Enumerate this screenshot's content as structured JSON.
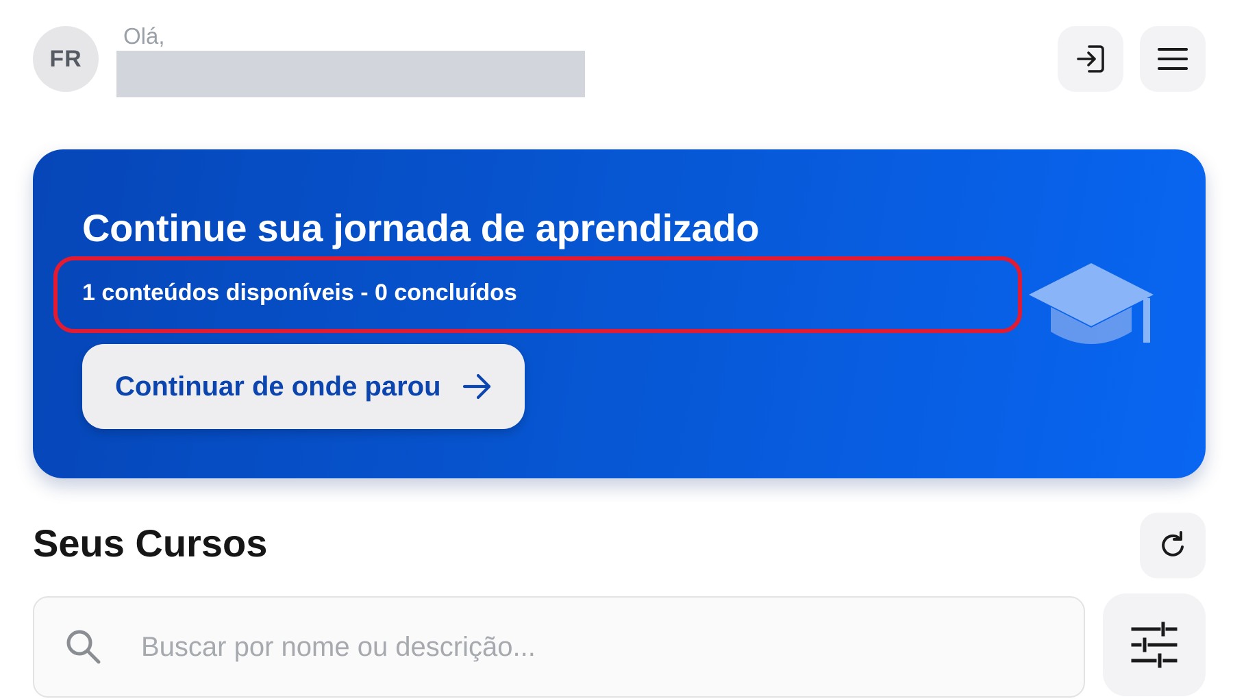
{
  "header": {
    "avatar_initials": "FR",
    "greeting": "Olá,",
    "user_name": ""
  },
  "hero": {
    "title": "Continue sua jornada de aprendizado",
    "subtitle": "1 conteúdos disponíveis - 0 concluídos",
    "continue_label": "Continuar de onde parou",
    "highlight_color": "#e21b32",
    "card_color": "#0758d6"
  },
  "courses": {
    "title": "Seus Cursos",
    "search_placeholder": "Buscar por nome ou descrição..."
  },
  "icons": {
    "logout": "logout-icon",
    "menu": "hamburger-menu-icon",
    "graduation": "graduation-cap-icon",
    "arrow": "arrow-right-icon",
    "refresh": "refresh-icon",
    "search": "search-icon",
    "filter": "filter-sliders-icon"
  }
}
